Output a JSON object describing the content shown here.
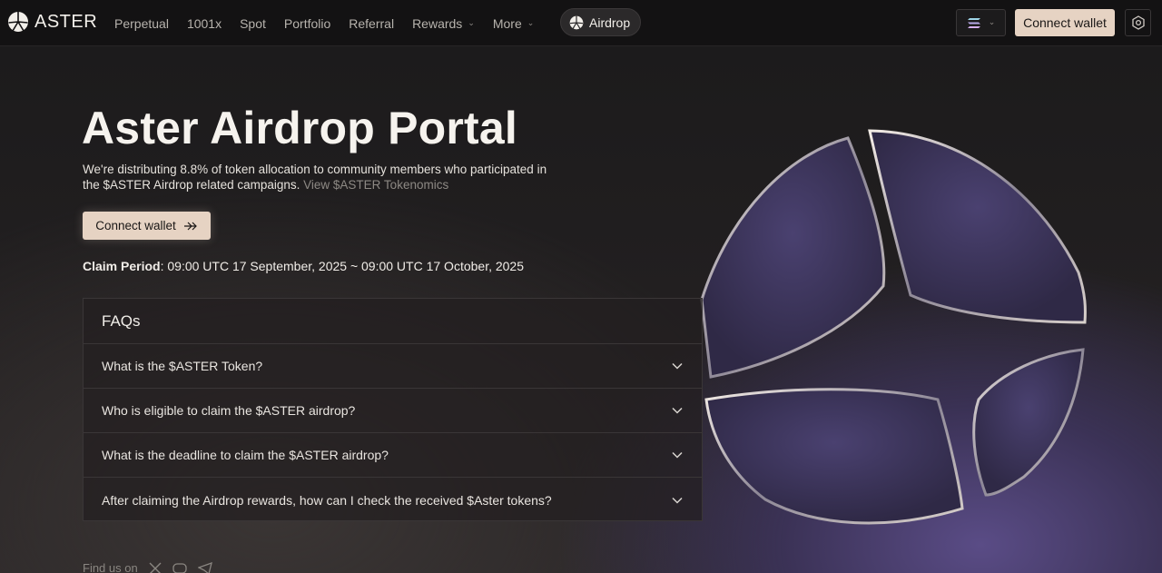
{
  "nav": {
    "brand": "ASTER",
    "links": [
      {
        "label": "Perpetual"
      },
      {
        "label": "1001x"
      },
      {
        "label": "Spot"
      },
      {
        "label": "Portfolio"
      },
      {
        "label": "Referral"
      },
      {
        "label": "Rewards"
      },
      {
        "label": "More"
      }
    ],
    "airdrop_label": "Airdrop",
    "network_icon": "solana-icon",
    "connect_label": "Connect wallet",
    "settings_icon": "settings-icon"
  },
  "hero": {
    "title": "Aster Airdrop Portal",
    "description": "We're distributing 8.8% of token allocation to community members who participated in the $ASTER Airdrop related campaigns.",
    "tokenomics_link": "View $ASTER Tokenomics",
    "connect_label": "Connect wallet",
    "claim_label": "Claim Period",
    "claim_value": ": 09:00 UTC 17 September, 2025 ~ 09:00 UTC 17 October, 2025"
  },
  "faq": {
    "title": "FAQs",
    "items": [
      {
        "question": "What is the $ASTER Token?"
      },
      {
        "question": "Who is eligible to claim the $ASTER airdrop?"
      },
      {
        "question": "What is the deadline to claim the $ASTER airdrop?"
      },
      {
        "question": "After claiming the Airdrop rewards, how can I check the received $Aster tokens?"
      }
    ]
  },
  "footer": {
    "follow_label": "Find us on",
    "socials": [
      "x-icon",
      "discord-icon",
      "telegram-icon"
    ]
  },
  "colors": {
    "accent": "#e6d3c3",
    "background": "#1b1a1b",
    "art_purple": "#3d3559"
  }
}
